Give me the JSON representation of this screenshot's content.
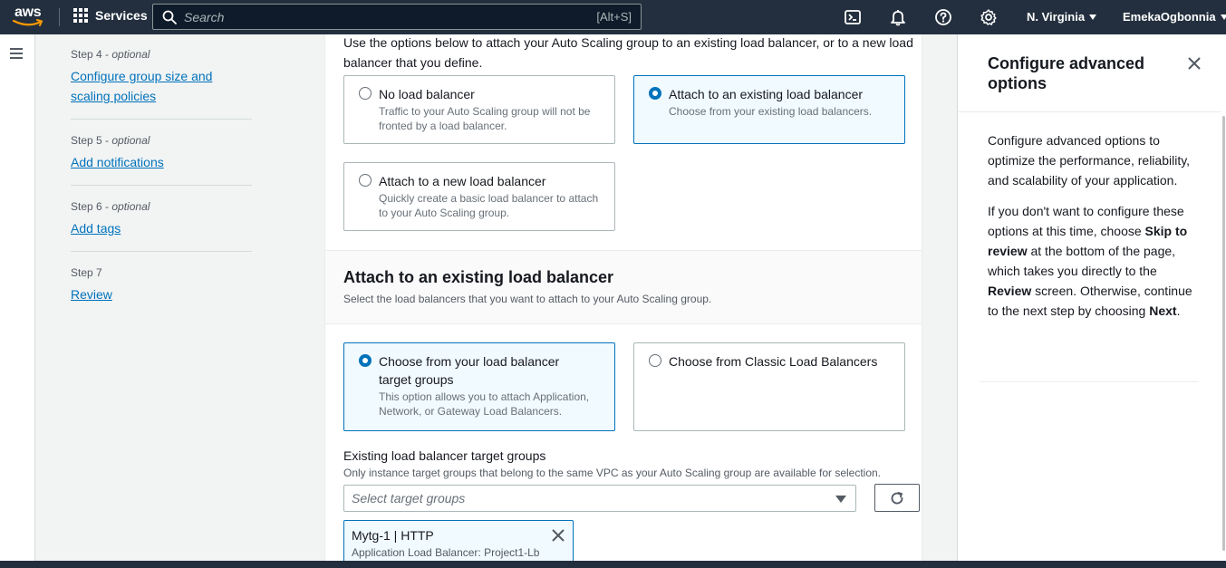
{
  "nav": {
    "logo_text": "aws",
    "services_label": "Services",
    "search_placeholder": "Search",
    "search_shortcut": "[Alt+S]",
    "region": "N. Virginia",
    "account": "EmekaOgbonnia"
  },
  "steps": [
    {
      "number": "Step 4",
      "optional": "optional",
      "link": "Configure group size and scaling policies"
    },
    {
      "number": "Step 5",
      "optional": "optional",
      "link": "Add notifications"
    },
    {
      "number": "Step 6",
      "optional": "optional",
      "link": "Add tags"
    },
    {
      "number": "Step 7",
      "optional": "",
      "link": "Review"
    }
  ],
  "load_balancing": {
    "intro": "Use the options below to attach your Auto Scaling group to an existing load balancer, or to a new load balancer that you define.",
    "options": [
      {
        "title": "No load balancer",
        "desc": "Traffic to your Auto Scaling group will not be fronted by a load balancer.",
        "selected": false
      },
      {
        "title": "Attach to an existing load balancer",
        "desc": "Choose from your existing load balancers.",
        "selected": true
      },
      {
        "title": "Attach to a new load balancer",
        "desc": "Quickly create a basic load balancer to attach to your Auto Scaling group.",
        "selected": false
      }
    ]
  },
  "existing_lb": {
    "title": "Attach to an existing load balancer",
    "desc": "Select the load balancers that you want to attach to your Auto Scaling group.",
    "options": [
      {
        "title": "Choose from your load balancer target groups",
        "desc": "This option allows you to attach Application, Network, or Gateway Load Balancers.",
        "selected": true
      },
      {
        "title": "Choose from Classic Load Balancers",
        "desc": "",
        "selected": false
      }
    ],
    "field_label": "Existing load balancer target groups",
    "field_desc": "Only instance target groups that belong to the same VPC as your Auto Scaling group are available for selection.",
    "select_placeholder": "Select target groups",
    "token_title": "Mytg-1 | HTTP",
    "token_sub": "Application Load Balancer: Project1-Lb"
  },
  "help": {
    "title": "Configure advanced options",
    "p1": "Configure advanced options to optimize the performance, reliability, and scalability of your application.",
    "p2_a": "If you don't want to configure these options at this time, choose ",
    "p2_b": "Skip to review",
    "p2_c": " at the bottom of the page, which takes you directly to the ",
    "p2_d": "Review",
    "p2_e": " screen. Otherwise, continue to the next step by choosing ",
    "p2_f": "Next",
    "p2_g": "."
  },
  "colors": {
    "nav_bg": "#232f3e",
    "link": "#0073bb",
    "selected_bg": "#f1faff"
  }
}
